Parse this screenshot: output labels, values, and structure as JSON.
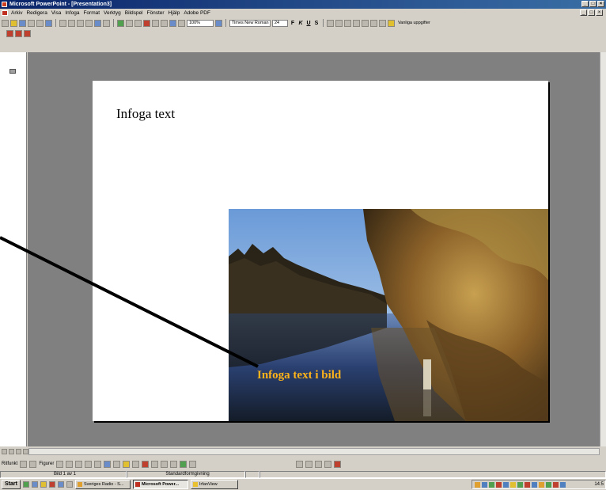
{
  "window": {
    "title": "Microsoft PowerPoint - [Presentation3]",
    "controls": [
      "_",
      "□",
      "×"
    ]
  },
  "menu": {
    "items": [
      "Arkiv",
      "Redigera",
      "Visa",
      "Infoga",
      "Format",
      "Verktyg",
      "Bildspel",
      "Fönster",
      "Hjälp",
      "Adobe PDF"
    ]
  },
  "toolbar": {
    "zoom": "100%",
    "font": "Times New Roman",
    "size": "24",
    "bold": "F",
    "italic": "K",
    "underline": "U",
    "shadow": "S",
    "help": "Vanliga uppgifter"
  },
  "slide": {
    "title_text": "Infoga text",
    "image_caption": "Infoga text i bild"
  },
  "drawing": {
    "ritfunktioner": "Ritfunkt",
    "figurer": "Figurer"
  },
  "status": {
    "slide_info": "Bild 1 av 1",
    "design": "Standardformgivning"
  },
  "taskbar": {
    "start": "Start",
    "tasks": [
      "Sveriges Radio - S...",
      "Microsoft Power...",
      "IrfanView"
    ],
    "clock": "14:5"
  },
  "colors": {
    "titlebar": "#0a246a",
    "caption": "#ffb31a",
    "workspace": "#808080"
  }
}
